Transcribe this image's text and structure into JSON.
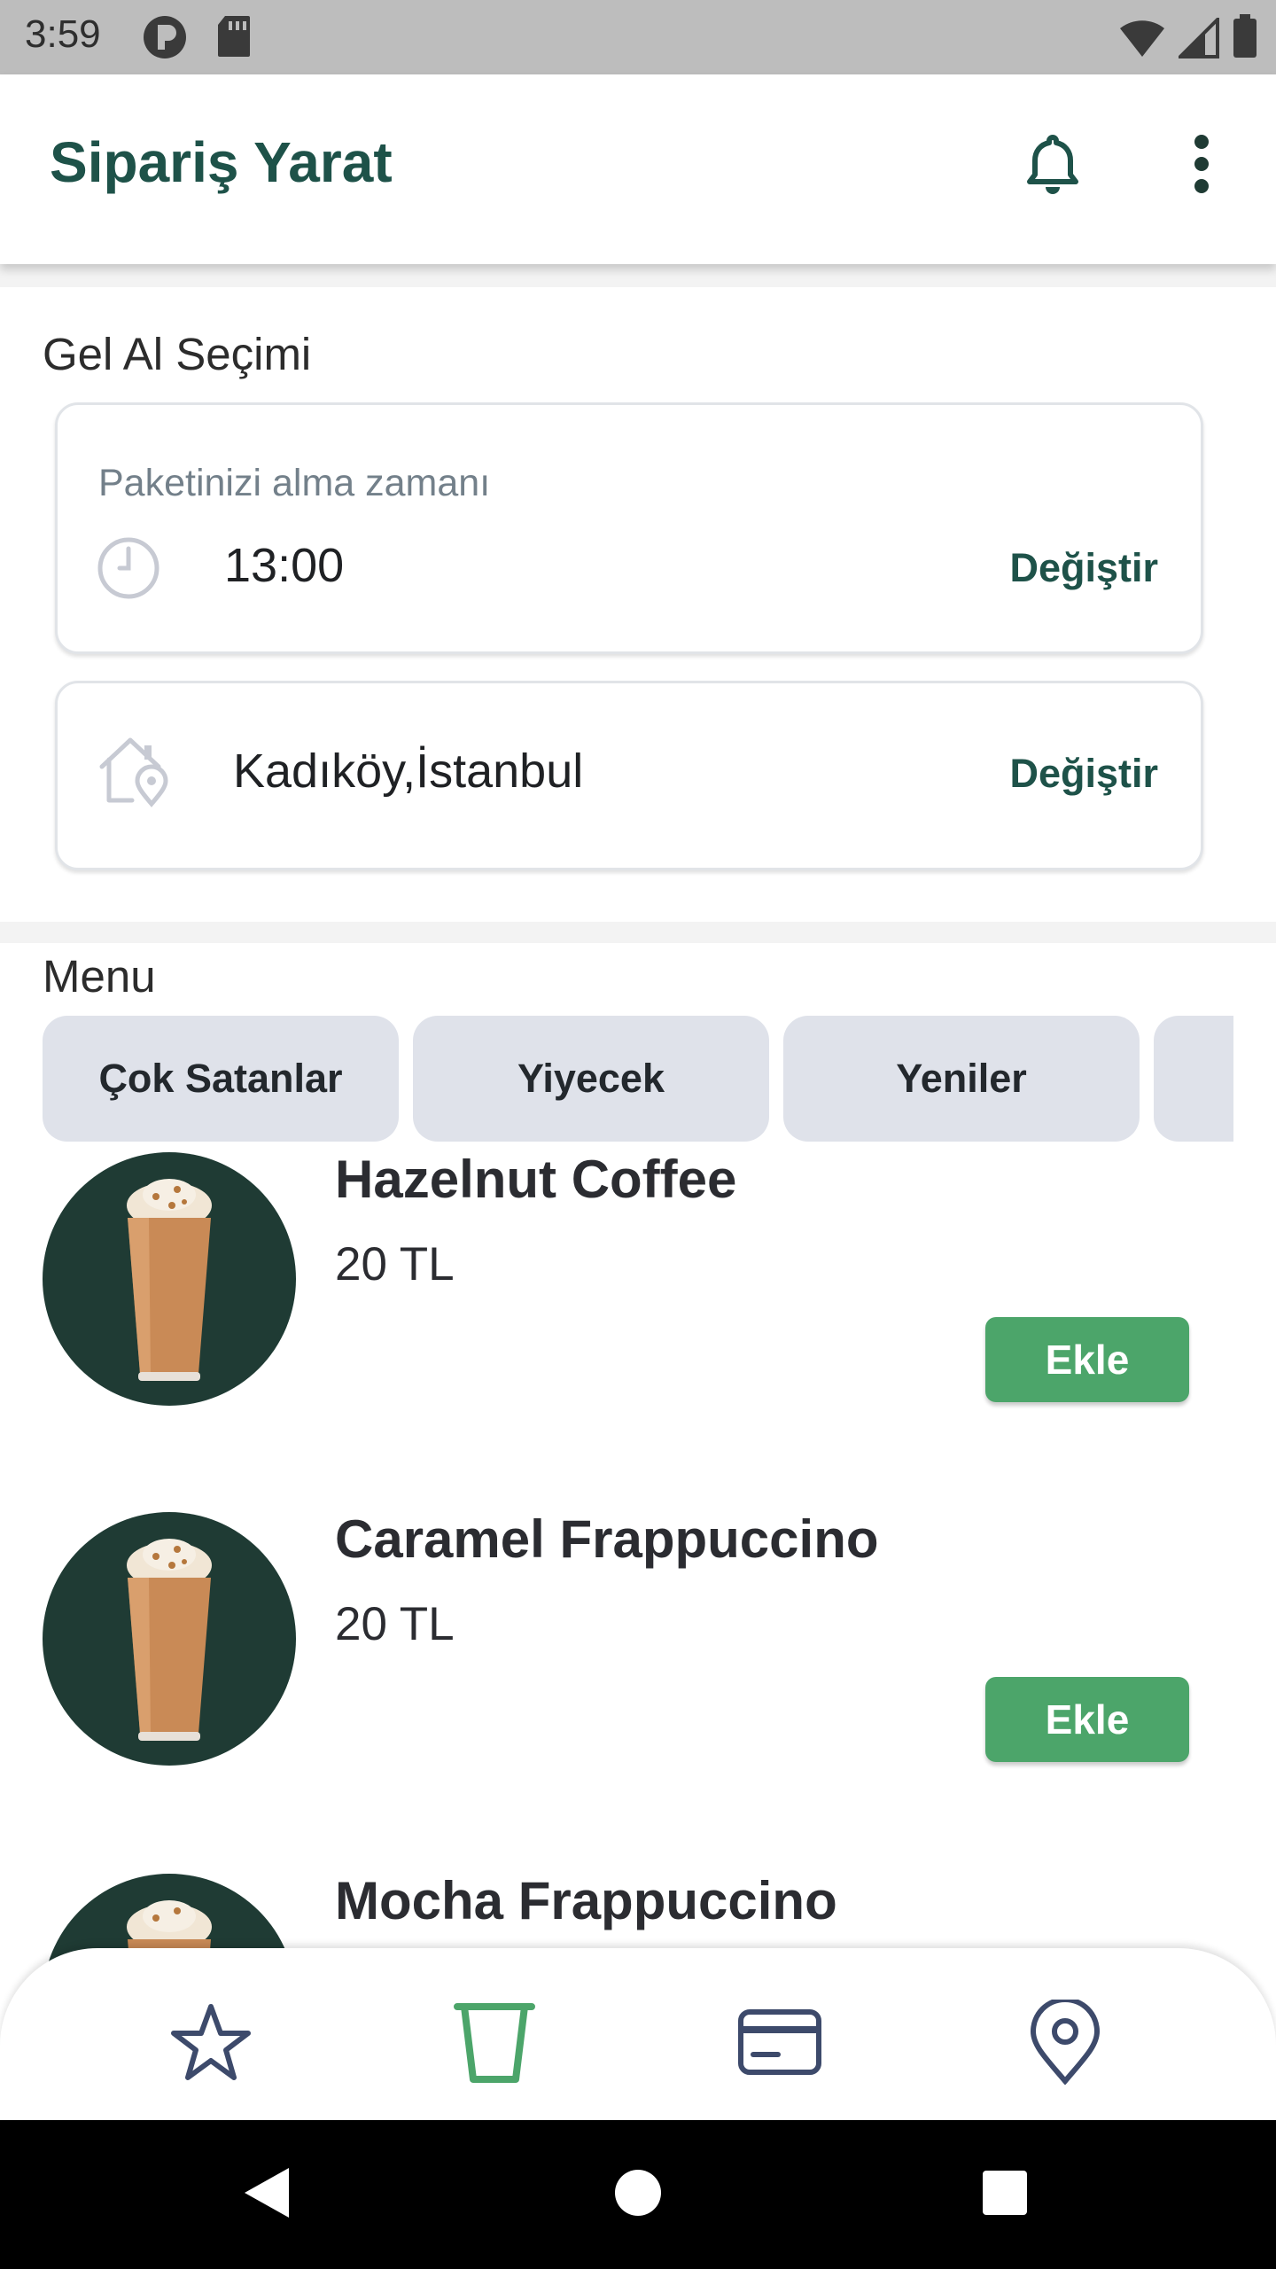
{
  "status_bar": {
    "time": "3:59"
  },
  "app_bar": {
    "title": "Sipariş Yarat"
  },
  "pickup": {
    "section_title": "Gel Al Seçimi",
    "time_card": {
      "label": "Paketinizi alma zamanı",
      "value": "13:00",
      "action": "Değiştir"
    },
    "location_card": {
      "value": "Kadıköy,İstanbul",
      "action": "Değiştir"
    }
  },
  "menu": {
    "section_title": "Menu",
    "categories": [
      "Çok Satanlar",
      "Yiyecek",
      "Yeniler"
    ],
    "products": [
      {
        "name": "Hazelnut Coffee",
        "price": "20 TL",
        "action": "Ekle"
      },
      {
        "name": "Caramel Frappuccino",
        "price": "20 TL",
        "action": "Ekle"
      },
      {
        "name": "Mocha Frappuccino"
      }
    ]
  },
  "bottom_nav": {
    "items": [
      "star-icon",
      "cup-icon",
      "card-icon",
      "location-pin-icon"
    ],
    "active": "cup-icon"
  },
  "colors": {
    "brand": "#1e5249",
    "accent": "#4ca56a",
    "chip": "#dfe2ea",
    "thumb_bg": "#1f3b34"
  }
}
